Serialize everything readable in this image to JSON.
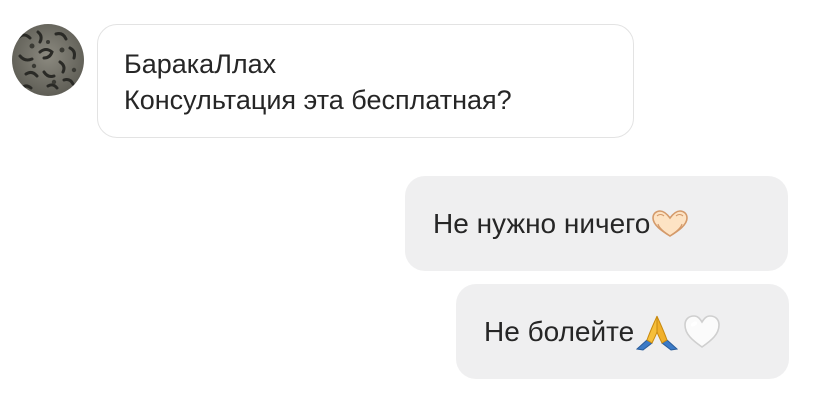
{
  "thread": {
    "incoming": {
      "avatar_icon": "snow-leopard-avatar-icon",
      "sender": "БаракаЛлах",
      "text": "Консультация эта бесплатная?"
    },
    "outgoing": [
      {
        "text": "Не нужно ничего",
        "emoji": [
          "heart-hands-icon"
        ]
      },
      {
        "text": "Не болейте",
        "emoji": [
          "folded-hands-icon",
          "white-heart-icon"
        ]
      }
    ]
  },
  "colors": {
    "incoming_bubble_border": "#e3e3e3",
    "outgoing_bubble_bg": "#efeff0",
    "text": "#262626"
  }
}
